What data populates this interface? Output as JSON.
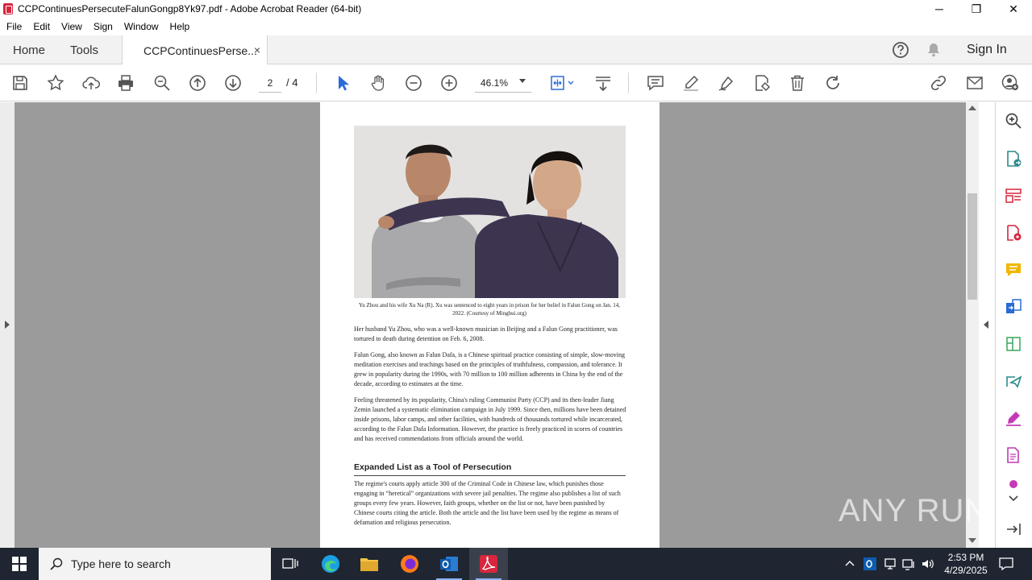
{
  "window": {
    "title": "CCPContinuesPersecuteFalunGongp8Yk97.pdf - Adobe Acrobat Reader (64-bit)",
    "minimize": "─",
    "restore": "❐",
    "close": "✕"
  },
  "menu": [
    "File",
    "Edit",
    "View",
    "Sign",
    "Window",
    "Help"
  ],
  "tabs": {
    "home": "Home",
    "tools": "Tools",
    "document": "CCPContinuesPerse...",
    "close": "×",
    "sign_in": "Sign In"
  },
  "toolbar": {
    "page_current": "2",
    "page_total": "/ 4",
    "zoom": "46.1%"
  },
  "document": {
    "caption": "Yu Zhou and his wife Xu Na (R). Xu was sentenced to eight years in prison for her belief in Falun Gong on Jan. 14, 2022. (Courtesy of Minghui.org)",
    "para1": "Her husband Yu Zhou, who was a well-known musician in Beijing and a Falun Gong practitioner, was tortured to death during detention on Feb. 6, 2008.",
    "para2": "Falun Gong, also known as Falun Dafa, is a Chinese spiritual practice consisting of simple, slow-moving meditation exercises and teachings based on the principles of truthfulness, compassion, and tolerance. It grew in popularity during the 1990s, with 70 million to 100 million adherents in China by the end of the decade, according to estimates at the time.",
    "para3": "Feeling threatened by its popularity, China's ruling Communist Party (CCP) and its then-leader Jiang Zemin launched a systematic elimination campaign in July 1999. Since then, millions have been detained inside prisons, labor camps, and other facilities, with hundreds of thousands tortured while incarcerated, according to the Falun Dafa Information. However, the practice is freely practiced in scores of countries and has received commendations from officials around the world.",
    "heading": "Expanded List as a Tool of Persecution",
    "para4": "The regime's courts apply article 300 of the Criminal Code in Chinese law, which punishes those engaging in “heretical” organizations with severe jail penalties. The regime also publishes a list of such groups every few years. However, faith groups, whether on the list or not, have been punished by Chinese courts citing the article. Both the article and the list have been used by the regime as means of defamation and religious persecution."
  },
  "watermark": "ANY RUN",
  "taskbar": {
    "search_placeholder": "Type here to search",
    "time": "2:53 PM",
    "date": "4/29/2025"
  },
  "colors": {
    "acrobat_red": "#d7263d",
    "tool_blue": "#2b6bd6",
    "taskbar": "#1f2631",
    "canvas_gray": "#9b9b9b"
  }
}
